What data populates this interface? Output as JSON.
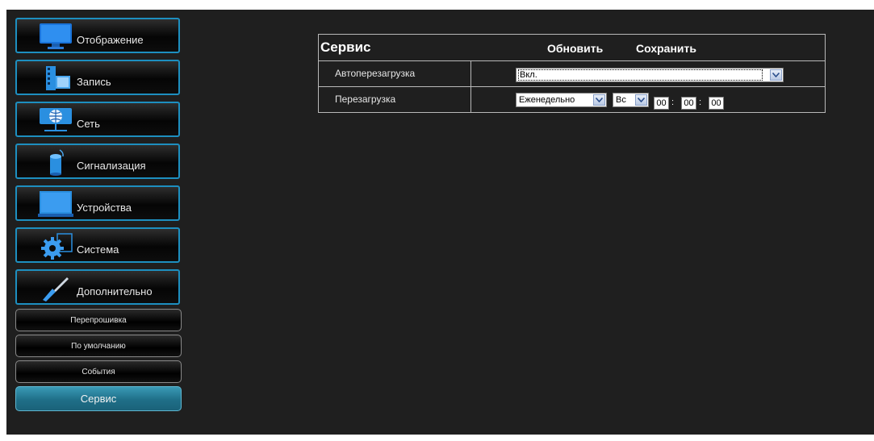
{
  "sidebar": {
    "items": [
      {
        "label": "Отображение",
        "icon": "monitor-icon"
      },
      {
        "label": "Запись",
        "icon": "film-icon"
      },
      {
        "label": "Сеть",
        "icon": "network-icon"
      },
      {
        "label": "Сигнализация",
        "icon": "alarm-icon"
      },
      {
        "label": "Устройства",
        "icon": "device-icon"
      },
      {
        "label": "Система",
        "icon": "gear-icon"
      },
      {
        "label": "Дополнительно",
        "icon": "screwdriver-icon"
      }
    ],
    "sub_items": [
      {
        "label": "Перепрошивка"
      },
      {
        "label": "По умолчанию"
      },
      {
        "label": "События"
      },
      {
        "label": "Сервис",
        "active": true
      }
    ]
  },
  "panel": {
    "title": "Сервис",
    "refresh_label": "Обновить",
    "save_label": "Сохранить",
    "rows": {
      "auto_reboot": {
        "label": "Автоперезагрузка",
        "value": "Вкл."
      },
      "reboot": {
        "label": "Перезагрузка",
        "frequency": "Еженедельно",
        "day": "Вс",
        "hour": "00",
        "minute": "00",
        "second": "00",
        "separator": ":"
      }
    }
  },
  "colors": {
    "background": "#1f1f1f",
    "accent": "#1d8fc0",
    "active_tab": "#2a86a3"
  }
}
